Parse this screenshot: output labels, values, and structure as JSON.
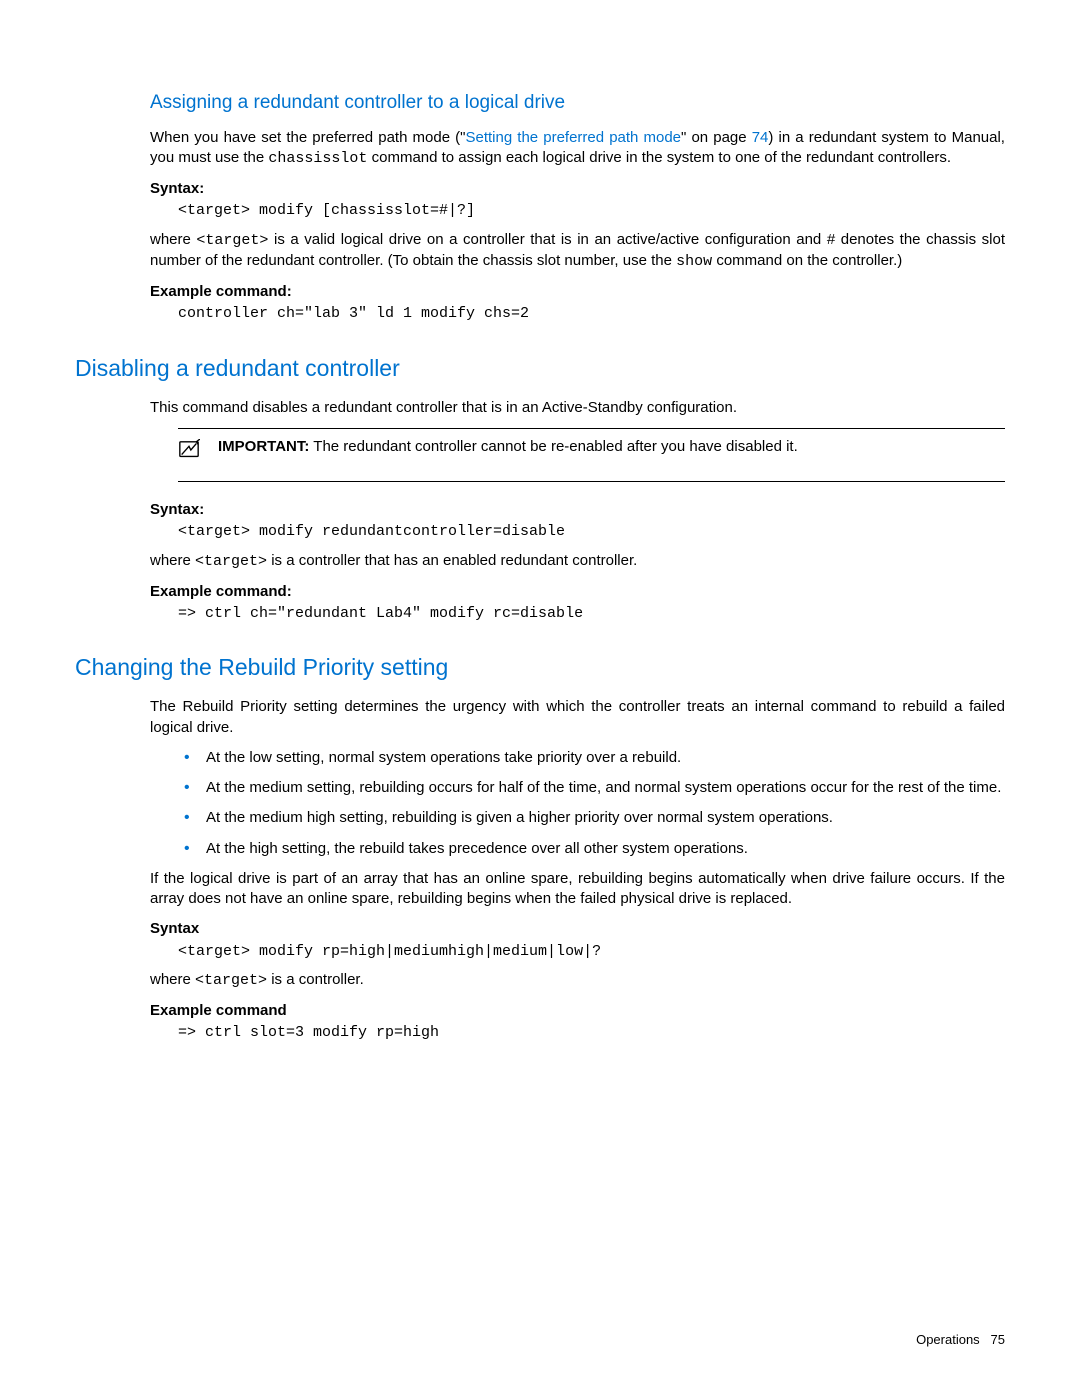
{
  "section1": {
    "heading": "Assigning a redundant controller to a logical drive",
    "para1_a": "When you have set the preferred path mode (\"",
    "para1_link": "Setting the preferred path mode",
    "para1_b": "\" on page ",
    "para1_page": "74",
    "para1_c": ") in a redundant system to Manual, you must use the ",
    "para1_code": "chassisslot",
    "para1_d": " command to assign each logical drive in the system to one of the redundant controllers.",
    "syntax_label": "Syntax:",
    "syntax_code": "<target> modify [chassisslot=#|?]",
    "para2_a": "where ",
    "para2_code1": "<target>",
    "para2_b": " is a valid logical drive on a controller that is in an active/active configuration and # denotes the chassis slot number of the redundant controller. (To obtain the chassis slot number, use the ",
    "para2_code2": "show",
    "para2_c": " command on the controller.)",
    "example_label": "Example command:",
    "example_code": "controller ch=\"lab 3\" ld 1 modify chs=2"
  },
  "section2": {
    "heading": "Disabling a redundant controller",
    "para1": "This command disables a redundant controller that is in an Active-Standby configuration.",
    "important_label": "IMPORTANT:",
    "important_text": "   The redundant controller cannot be re-enabled after you have disabled it.",
    "syntax_label": "Syntax:",
    "syntax_code": "<target> modify redundantcontroller=disable",
    "para2_a": "where ",
    "para2_code": "<target>",
    "para2_b": " is a controller that has an enabled redundant controller.",
    "example_label": "Example command:",
    "example_code": "=> ctrl ch=\"redundant Lab4\" modify rc=disable"
  },
  "section3": {
    "heading": "Changing the Rebuild Priority setting",
    "para1": "The Rebuild Priority setting determines the urgency with which the controller treats an internal command to rebuild a failed logical drive.",
    "bullets": [
      "At the low setting, normal system operations take priority over a rebuild.",
      "At the medium setting, rebuilding occurs for half of the time, and normal system operations occur for the rest of the time.",
      "At the medium high setting, rebuilding is given a higher priority over normal system operations.",
      "At the high setting, the rebuild takes precedence over all other system operations."
    ],
    "para2": "If the logical drive is part of an array that has an online spare, rebuilding begins automatically when drive failure occurs. If the array does not have an online spare, rebuilding begins when the failed physical drive is replaced.",
    "syntax_label": "Syntax",
    "syntax_code": "<target> modify rp=high|mediumhigh|medium|low|?",
    "para3_a": "where ",
    "para3_code": "<target>",
    "para3_b": " is a controller.",
    "example_label": "Example command",
    "example_code": "=> ctrl slot=3 modify rp=high"
  },
  "footer": {
    "title": "Operations",
    "page": "75"
  }
}
